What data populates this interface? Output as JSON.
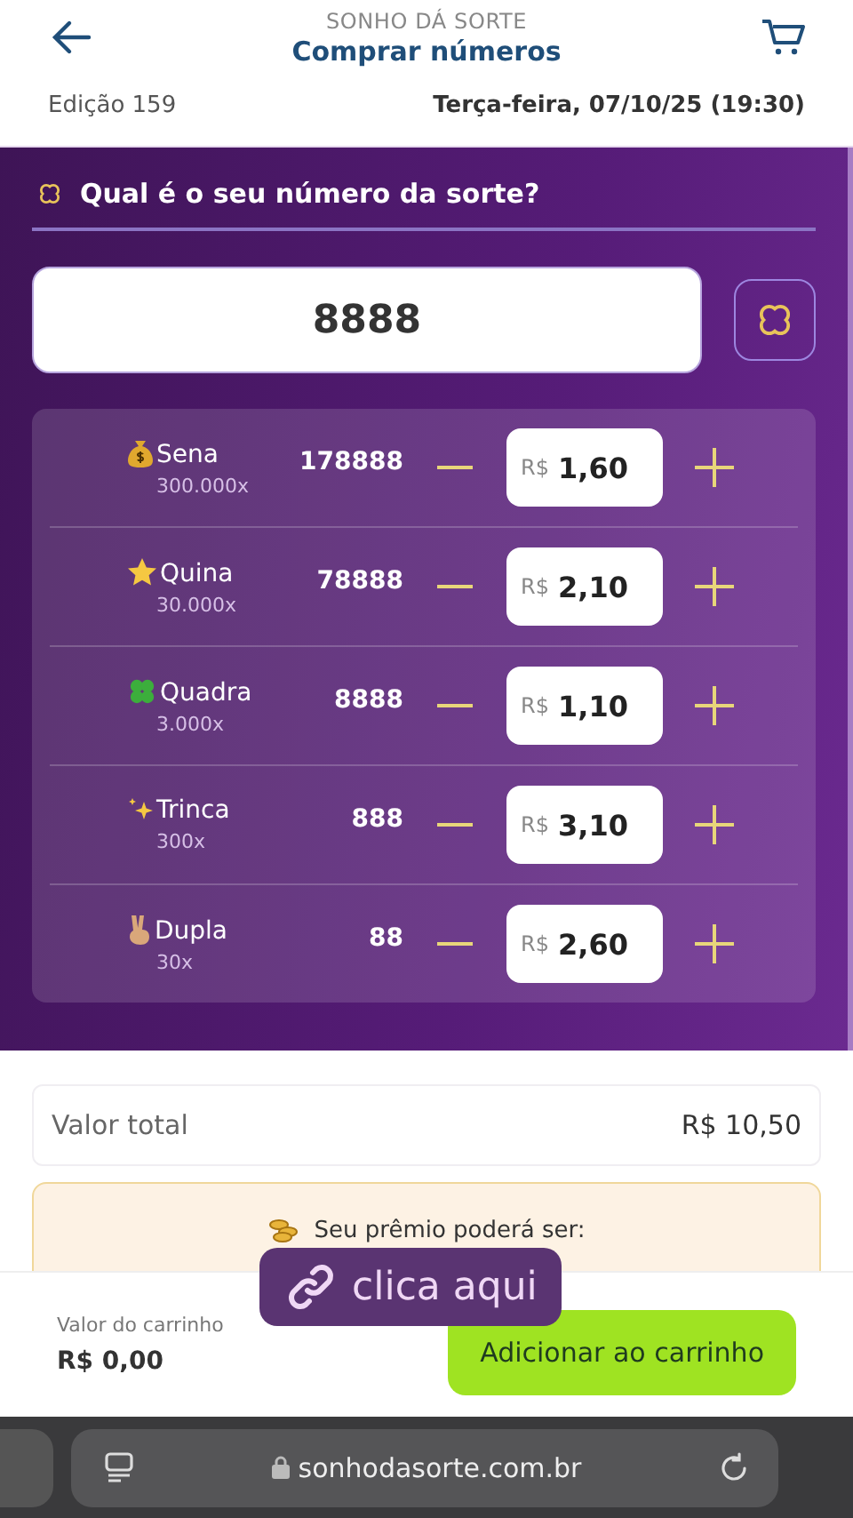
{
  "header": {
    "brand": "SONHO DÁ SORTE",
    "title": "Comprar números"
  },
  "draw_info": {
    "edition": "Edição 159",
    "date": "Terça-feira, 07/10/25 (19:30)"
  },
  "lucky_number": {
    "question": "Qual é o seu número da sorte?",
    "value": "8888"
  },
  "bets": [
    {
      "kind": "money",
      "name": "Sena",
      "multiplier": "300.000x",
      "number": "178888",
      "currency": "R$",
      "amount": "1,60"
    },
    {
      "kind": "star",
      "name": "Quina",
      "multiplier": "30.000x",
      "number": "78888",
      "currency": "R$",
      "amount": "2,10"
    },
    {
      "kind": "clover",
      "name": "Quadra",
      "multiplier": "3.000x",
      "number": "8888",
      "currency": "R$",
      "amount": "1,10"
    },
    {
      "kind": "sparkles",
      "name": "Trinca",
      "multiplier": "300x",
      "number": "888",
      "currency": "R$",
      "amount": "3,10"
    },
    {
      "kind": "peace",
      "name": "Dupla",
      "multiplier": "30x",
      "number": "88",
      "currency": "R$",
      "amount": "2,60"
    }
  ],
  "total": {
    "label": "Valor total",
    "value": "R$ 10,50"
  },
  "prize_banner": {
    "text": "Seu prêmio poderá ser:"
  },
  "cart_bar": {
    "label": "Valor do carrinho",
    "value": "R$ 0,00",
    "button": "Adicionar ao carrinho"
  },
  "link_sticker": {
    "text": "clica aqui"
  },
  "browser_bar": {
    "url": "sonhodasorte.com.br"
  }
}
